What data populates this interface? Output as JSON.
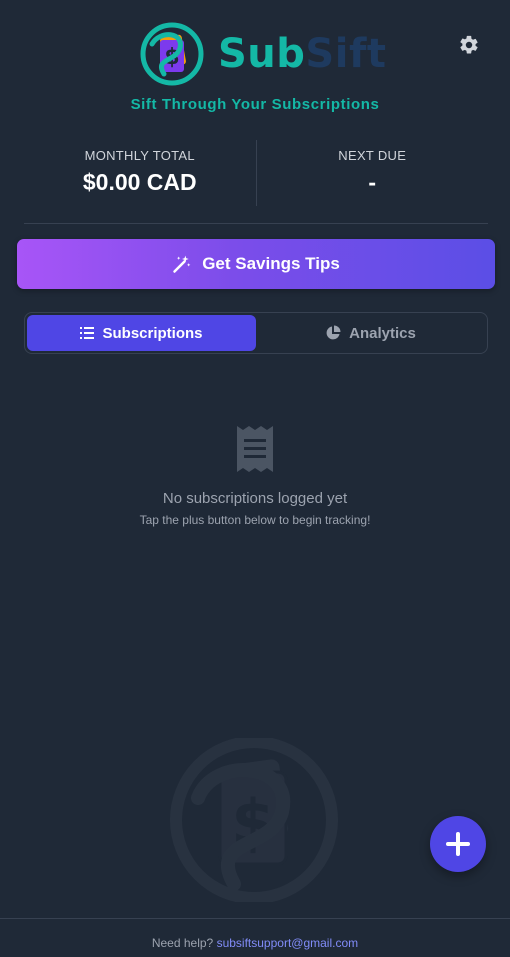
{
  "app": {
    "brand_part1": "Sub",
    "brand_part2": "Sift",
    "tagline": "Sift Through Your Subscriptions",
    "logo_icon": "subsift-logo",
    "settings_icon": "gear-icon"
  },
  "stats": {
    "monthly_total_label": "MONTHLY TOTAL",
    "monthly_total_value": "$0.00 CAD",
    "next_due_label": "NEXT DUE",
    "next_due_value": "-"
  },
  "actions": {
    "tips_label": "Get Savings Tips",
    "tips_icon": "magic-wand-icon"
  },
  "tabs": [
    {
      "label": "Subscriptions",
      "icon": "list-icon",
      "active": true
    },
    {
      "label": "Analytics",
      "icon": "pie-chart-icon",
      "active": false
    }
  ],
  "empty_state": {
    "icon": "receipt-icon",
    "title": "No subscriptions logged yet",
    "subtitle": "Tap the plus button below to begin tracking!"
  },
  "fab": {
    "icon": "plus-icon"
  },
  "footer": {
    "prefix": "Need help?",
    "email": "subsiftsupport@gmail.com"
  },
  "colors": {
    "background": "#1f2937",
    "accent_teal": "#14b8a6",
    "accent_indigo": "#4f46e5",
    "gradient_start": "#a855f7"
  }
}
